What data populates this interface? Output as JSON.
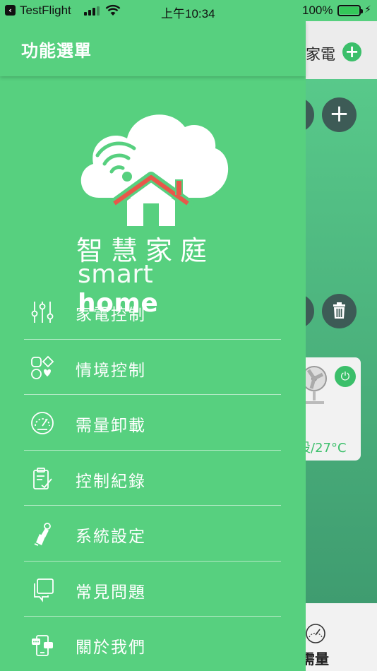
{
  "status_bar": {
    "back_app": "TestFlight",
    "time": "上午10:34",
    "battery_percent": "100%",
    "battery_level": 1.0
  },
  "background_screen": {
    "header_title": "家電",
    "card_temp": "設/27°C",
    "tab_label": "需量"
  },
  "drawer": {
    "title": "功能選單",
    "brand_cn": "智慧家庭",
    "brand_en_thin": "smart ",
    "brand_en_bold": "home",
    "menu": [
      {
        "label": "家電控制",
        "icon": "sliders-icon"
      },
      {
        "label": "情境控制",
        "icon": "scene-icon"
      },
      {
        "label": "需量卸載",
        "icon": "gauge-icon"
      },
      {
        "label": "控制紀錄",
        "icon": "clipboard-icon"
      },
      {
        "label": "系統設定",
        "icon": "settings-hand-icon"
      },
      {
        "label": "常見問題",
        "icon": "faq-icon"
      },
      {
        "label": "關於我們",
        "icon": "about-phone-icon"
      }
    ]
  },
  "colors": {
    "drawer_green": "#57d07f",
    "roof_red": "#e8574a",
    "accent_green": "#3bbf6a"
  }
}
